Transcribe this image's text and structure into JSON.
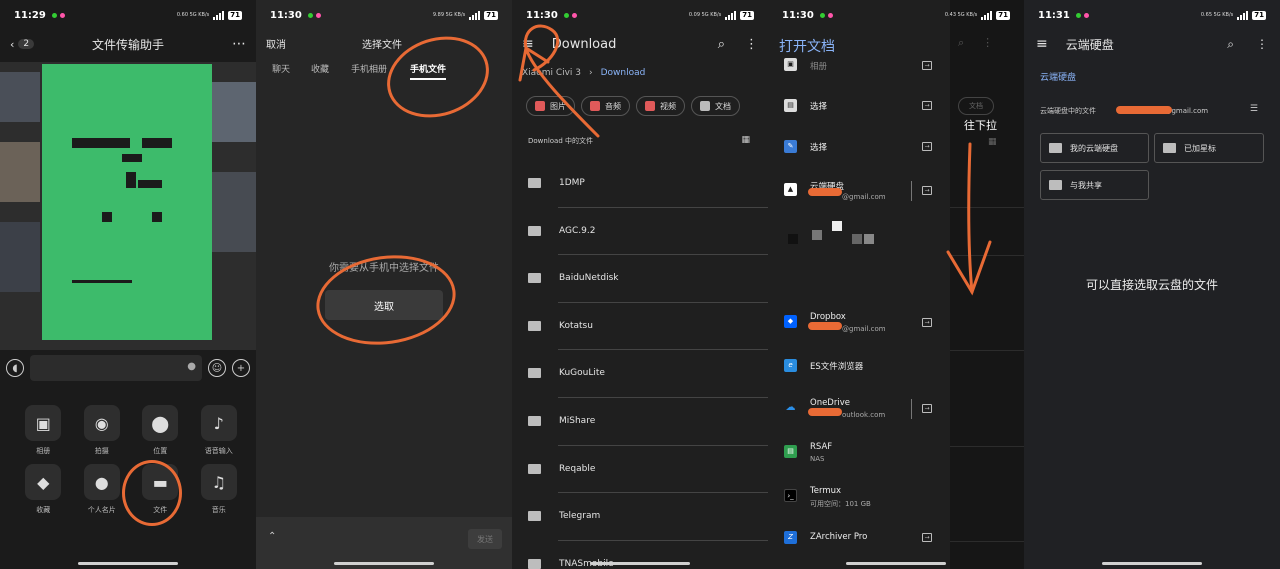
{
  "panel1": {
    "status": {
      "time": "11:29",
      "net": "0.60 5G KB/s",
      "battery": "71"
    },
    "back_count": "2",
    "title": "文件传输助手",
    "more": "⋯",
    "grid": [
      {
        "label": "相册",
        "icon": "photo-icon",
        "glyph": "▣"
      },
      {
        "label": "拍摄",
        "icon": "camera-icon",
        "glyph": "◉"
      },
      {
        "label": "位置",
        "icon": "location-icon",
        "glyph": "⬤"
      },
      {
        "label": "语音输入",
        "icon": "voice-input-icon",
        "glyph": "♪"
      },
      {
        "label": "收藏",
        "icon": "favorites-icon",
        "glyph": "◆"
      },
      {
        "label": "个人名片",
        "icon": "contact-card-icon",
        "glyph": "●"
      },
      {
        "label": "文件",
        "icon": "folder-icon",
        "glyph": "▬"
      },
      {
        "label": "音乐",
        "icon": "music-icon",
        "glyph": "♫"
      }
    ]
  },
  "panel2": {
    "status": {
      "time": "11:30",
      "net": "9.89 5G KB/s",
      "battery": "71"
    },
    "cancel": "取消",
    "title": "选择文件",
    "tabs": [
      "聊天",
      "收藏",
      "手机相册",
      "手机文件"
    ],
    "hint": "你需要从手机中选择文件",
    "pick": "选取",
    "send": "发送",
    "expand": "⌃"
  },
  "panel3": {
    "status": {
      "time": "11:30",
      "net": "0.09 5G KB/s",
      "battery": "71"
    },
    "title": "Download",
    "breadcrumb": [
      "Xiaomi Civi 3",
      "›",
      "Download"
    ],
    "chips": [
      "图片",
      "音频",
      "视频",
      "文档"
    ],
    "section": "Download 中的文件",
    "files": [
      "1DMP",
      "AGC.9.2",
      "BaiduNetdisk",
      "Kotatsu",
      "KuGouLite",
      "MiShare",
      "Reqable",
      "Telegram",
      "TNASmobile"
    ]
  },
  "panel4": {
    "status": {
      "time": "11:30",
      "net": "0.43 5G KB/s",
      "battery": "71"
    },
    "title": "打开文档",
    "annotation": "往下拉",
    "bg_chip": "文档",
    "providers": [
      {
        "name": "相册",
        "sub": ""
      },
      {
        "name": "选择",
        "sub": ""
      },
      {
        "name": "选择",
        "sub": ""
      },
      {
        "name": "云端硬盘",
        "sub": "@gmail.com"
      },
      {
        "name": "Dropbox",
        "sub": "@gmail.com"
      },
      {
        "name": "ES文件浏览器",
        "sub": ""
      },
      {
        "name": "OneDrive",
        "sub": "outlook.com"
      },
      {
        "name": "RSAF",
        "sub": "NAS"
      },
      {
        "name": "Termux",
        "sub": "可用空间：101 GB"
      },
      {
        "name": "ZArchiver Pro",
        "sub": ""
      }
    ]
  },
  "panel5": {
    "status": {
      "time": "11:31",
      "net": "0.65 5G KB/s",
      "battery": "71"
    },
    "title": "云端硬盘",
    "crumb": "云端硬盘",
    "section": "云端硬盘中的文件",
    "account": "3@gmail.com",
    "folders": [
      "我的云端硬盘",
      "已加星标",
      "与我共享"
    ],
    "note": "可以直接选取云盘的文件"
  },
  "colors": {
    "accent": "#8ab4f8",
    "annotation": "#e86a35",
    "green": "#3dbb6b"
  }
}
